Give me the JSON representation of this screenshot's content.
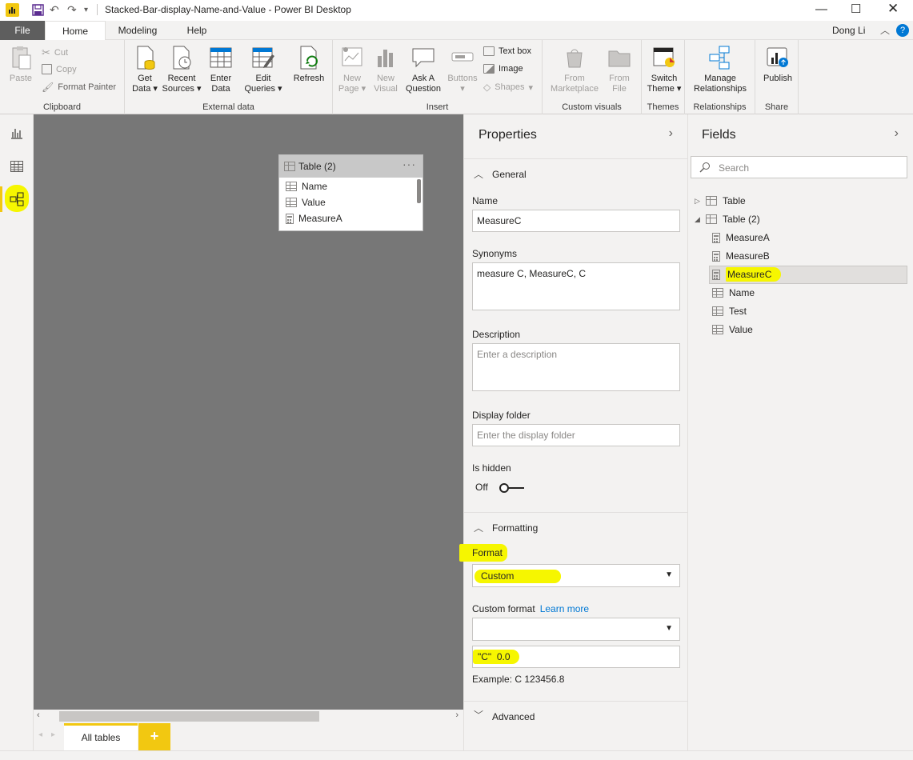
{
  "app": {
    "window_title": "Stacked-Bar-display-Name-and-Value - Power BI Desktop",
    "user": "Dong Li"
  },
  "tabs": {
    "file": "File",
    "home": "Home",
    "modeling": "Modeling",
    "help": "Help"
  },
  "ribbon": {
    "clipboard": {
      "paste": "Paste",
      "cut": "Cut",
      "copy": "Copy",
      "format_painter": "Format Painter",
      "label": "Clipboard"
    },
    "external_data": {
      "get_data": "Get",
      "get_data2": "Data",
      "recent_sources": "Recent",
      "recent_sources2": "Sources",
      "enter_data": "Enter",
      "enter_data2": "Data",
      "edit_queries": "Edit",
      "edit_queries2": "Queries",
      "refresh": "Refresh",
      "label": "External data"
    },
    "insert": {
      "new_page": "New",
      "new_page2": "Page",
      "new_visual": "New",
      "new_visual2": "Visual",
      "ask_question": "Ask A",
      "ask_question2": "Question",
      "buttons": "Buttons",
      "text_box": "Text box",
      "image": "Image",
      "shapes": "Shapes",
      "label": "Insert"
    },
    "custom_visuals": {
      "from_marketplace": "From",
      "from_marketplace2": "Marketplace",
      "from_file": "From",
      "from_file2": "File",
      "label": "Custom visuals"
    },
    "themes": {
      "switch_theme": "Switch",
      "switch_theme2": "Theme",
      "label": "Themes"
    },
    "relationships": {
      "manage": "Manage",
      "manage2": "Relationships",
      "label": "Relationships"
    },
    "share": {
      "publish": "Publish",
      "label": "Share"
    }
  },
  "canvas": {
    "table_card": {
      "title": "Table (2)",
      "more": "···",
      "rows": [
        "Name",
        "Value",
        "MeasureA"
      ]
    }
  },
  "bottom": {
    "all_tables": "All tables",
    "add": "+"
  },
  "properties": {
    "title": "Properties",
    "general": "General",
    "name_label": "Name",
    "name_value": "MeasureC",
    "synonyms_label": "Synonyms",
    "synonyms_value": "measure C, MeasureC, C",
    "description_label": "Description",
    "description_placeholder": "Enter a description",
    "display_folder_label": "Display folder",
    "display_folder_placeholder": "Enter the display folder",
    "is_hidden_label": "Is hidden",
    "is_hidden_value": "Off",
    "formatting": "Formatting",
    "format_label": "Format",
    "format_value": "Custom",
    "custom_format_label": "Custom format",
    "learn_more": "Learn more",
    "custom_format_value": "\"C\"  0.0",
    "example": "Example: C 123456.8",
    "advanced": "Advanced"
  },
  "fields": {
    "title": "Fields",
    "search_placeholder": "Search",
    "tables": [
      {
        "name": "Table",
        "expanded": false
      },
      {
        "name": "Table (2)",
        "expanded": true
      }
    ],
    "items": [
      "MeasureA",
      "MeasureB",
      "MeasureC",
      "Name",
      "Test",
      "Value"
    ],
    "selected": "MeasureC"
  },
  "colors": {
    "accent": "#f2c811",
    "highlight": "#f6f600",
    "canvas": "#777777",
    "link": "#0078d4"
  }
}
